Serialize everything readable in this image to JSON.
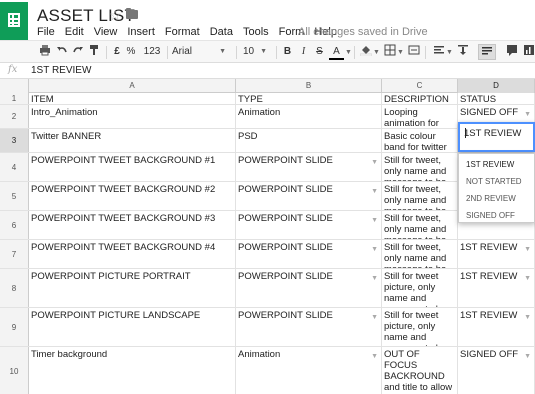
{
  "app": {
    "title": "ASSET LIST",
    "save_status": "All changes saved in Drive"
  },
  "menu": [
    "File",
    "Edit",
    "View",
    "Insert",
    "Format",
    "Data",
    "Tools",
    "Form",
    "Help"
  ],
  "toolbar": {
    "currency": "£",
    "percent": "%",
    "number_format": "123",
    "font": "Arial",
    "font_size": "10",
    "bold": "B",
    "italic": "I",
    "strike": "S",
    "text_color": "A"
  },
  "formula_bar": {
    "fx": "fx",
    "value": "1ST REVIEW"
  },
  "columns": [
    "A",
    "B",
    "C",
    "D"
  ],
  "rows": [
    {
      "num": "1",
      "item": "ITEM",
      "type": "TYPE",
      "description": "DESCRIPTION",
      "status": "STATUS"
    },
    {
      "num": "2",
      "item": "Intro_Animation",
      "type": "Animation",
      "description": "Looping animation for intro sequence",
      "status": "SIGNED OFF"
    },
    {
      "num": "3",
      "item": "Twitter BANNER",
      "type": "PSD",
      "description": "Basic colour band for twitter background",
      "status": "1ST REVIEW"
    },
    {
      "num": "4",
      "item": "POWERPOINT TWEET BACKGROUND #1",
      "type": "POWERPOINT SLIDE",
      "description": "Still for tweet, only name and message to be shown",
      "status": ""
    },
    {
      "num": "5",
      "item": "POWERPOINT TWEET BACKGROUND #2",
      "type": "POWERPOINT SLIDE",
      "description": "Still for tweet, only name and message to be shown",
      "status": ""
    },
    {
      "num": "6",
      "item": "POWERPOINT TWEET BACKGROUND #3",
      "type": "POWERPOINT SLIDE",
      "description": "Still for tweet, only name and message to be shown",
      "status": ""
    },
    {
      "num": "7",
      "item": "POWERPOINT TWEET BACKGROUND #4",
      "type": "POWERPOINT SLIDE",
      "description": "Still for tweet, only name and message to be shown",
      "status": "1ST REVIEW"
    },
    {
      "num": "8",
      "item": "POWERPOINT PICTURE PORTRAIT",
      "type": "POWERPOINT SLIDE",
      "description": "Still for tweet picture, only name and message to be shown",
      "status": "1ST REVIEW"
    },
    {
      "num": "9",
      "item": "POWERPOINT PICTURE LANDSCAPE",
      "type": "POWERPOINT SLIDE",
      "description": "Still for tweet picture, only name and message to be shown",
      "status": "1ST REVIEW"
    },
    {
      "num": "10",
      "item": "Timer background",
      "type": "Animation",
      "description": "OUT OF FOCUS BACKROUND and title to allow countdown to be placed over",
      "status": "SIGNED OFF"
    }
  ],
  "status_dropdown": {
    "options": [
      "1ST REVIEW",
      "NOT STARTED",
      "2ND REVIEW",
      "SIGNED OFF"
    ],
    "selected": "1ST REVIEW"
  },
  "colors": {
    "sheets_green": "#0f9d58",
    "selection_blue": "#4d90fe"
  }
}
